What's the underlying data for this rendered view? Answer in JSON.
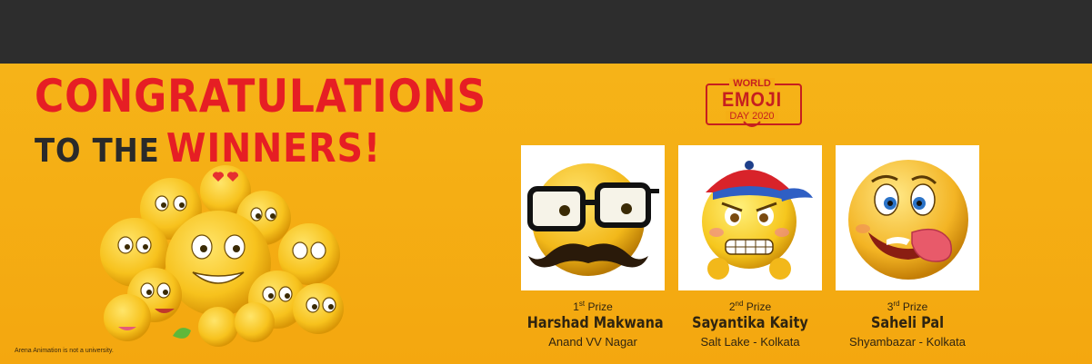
{
  "headline": {
    "line1": "CONGRATULATIONS",
    "line2_dark": "TO THE",
    "line2_red": "WINNERS!"
  },
  "disclaimer": "Arena Animation is not a university.",
  "logo": {
    "line1": "WORLD",
    "line2": "EMOJI",
    "line3": "DAY 2020"
  },
  "winners": [
    {
      "prize_num": "1",
      "prize_suffix": "st",
      "prize_label": "Prize",
      "name": "Harshad Makwana",
      "location": "Anand VV Nagar"
    },
    {
      "prize_num": "2",
      "prize_suffix": "nd",
      "prize_label": "Prize",
      "name": "Sayantika Kaity",
      "location": "Salt Lake - Kolkata"
    },
    {
      "prize_num": "3",
      "prize_suffix": "rd",
      "prize_label": "Prize",
      "name": "Saheli Pal",
      "location": "Shyambazar - Kolkata"
    }
  ],
  "colors": {
    "background": "#f4a70f",
    "top_bar": "#2d2d2d",
    "accent_red": "#e61e24",
    "dark_text": "#2a2a2a"
  }
}
